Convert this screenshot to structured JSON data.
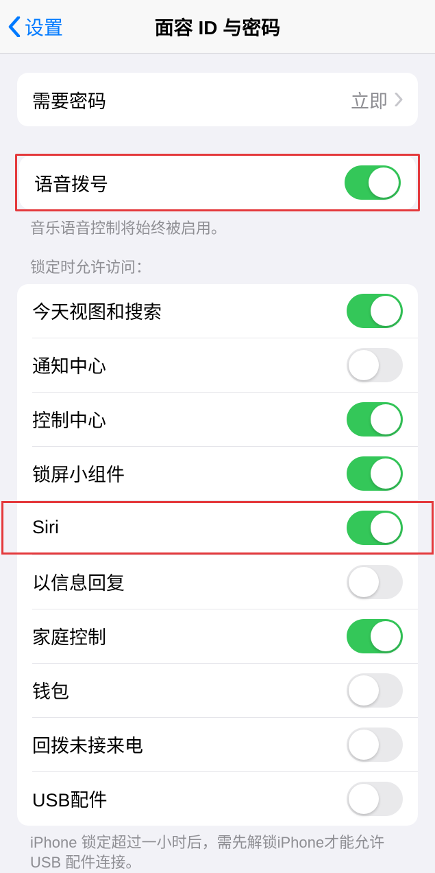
{
  "header": {
    "back_label": "设置",
    "title": "面容 ID 与密码"
  },
  "require_passcode": {
    "label": "需要密码",
    "value": "立即"
  },
  "voice_dial": {
    "label": "语音拨号",
    "footer": "音乐语音控制将始终被启用。",
    "on": true
  },
  "lock_access": {
    "header": "锁定时允许访问：",
    "items": [
      {
        "label": "今天视图和搜索",
        "on": true
      },
      {
        "label": "通知中心",
        "on": false
      },
      {
        "label": "控制中心",
        "on": true
      },
      {
        "label": "锁屏小组件",
        "on": true
      },
      {
        "label": "Siri",
        "on": true
      },
      {
        "label": "以信息回复",
        "on": false
      },
      {
        "label": "家庭控制",
        "on": true
      },
      {
        "label": "钱包",
        "on": false
      },
      {
        "label": "回拨未接来电",
        "on": false
      },
      {
        "label": "USB配件",
        "on": false
      }
    ],
    "footer": "iPhone 锁定超过一小时后，需先解锁iPhone才能允许USB 配件连接。"
  }
}
